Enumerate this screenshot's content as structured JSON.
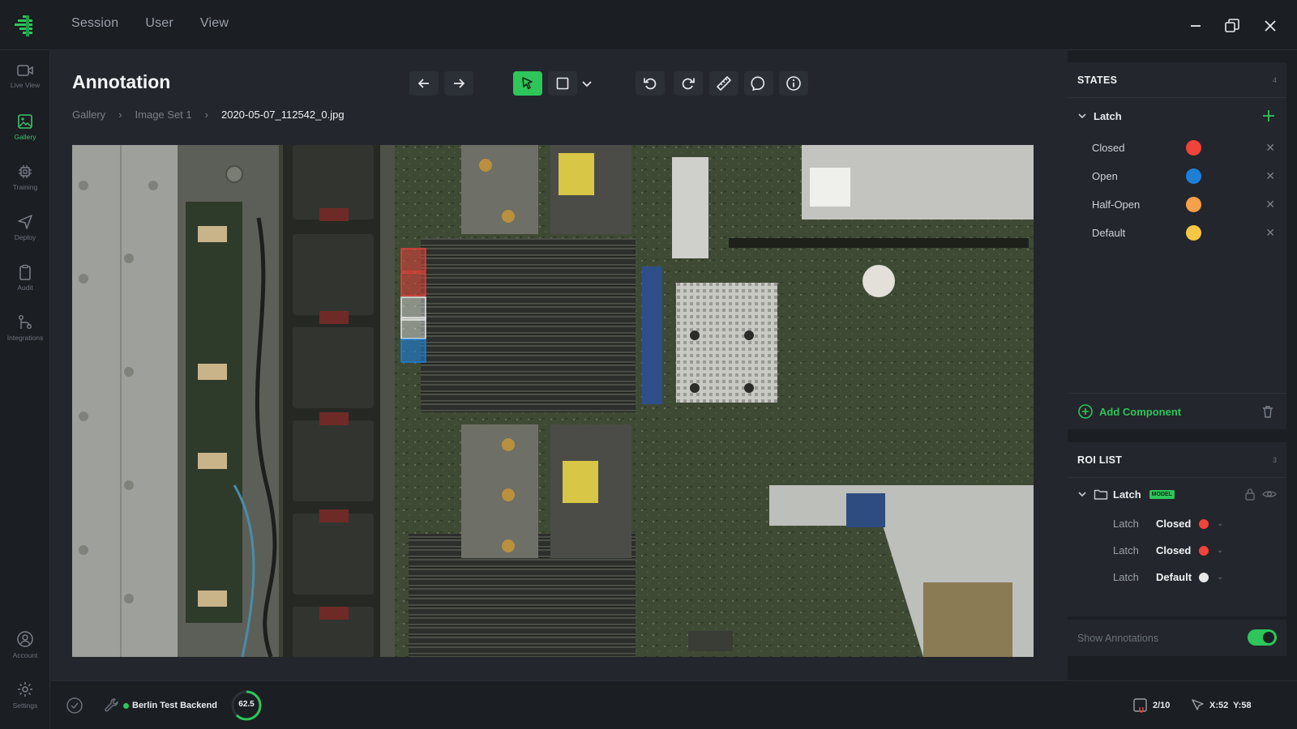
{
  "menu": [
    "Session",
    "User",
    "View"
  ],
  "sidebar": {
    "items": [
      {
        "label": "Live View",
        "icon": "video-camera-icon"
      },
      {
        "label": "Gallery",
        "icon": "image-icon",
        "active": true
      },
      {
        "label": "Training",
        "icon": "chip-icon"
      },
      {
        "label": "Deploy",
        "icon": "send-icon"
      },
      {
        "label": "Audit",
        "icon": "clipboard-icon"
      },
      {
        "label": "Integrations",
        "icon": "integrations-icon"
      }
    ],
    "account_label": "Account",
    "settings_label": "Settings"
  },
  "page": {
    "title": "Annotation",
    "breadcrumb": [
      "Gallery",
      "Image Set 1",
      "2020-05-07_112542_0.jpg"
    ]
  },
  "toolbar": {
    "tools": [
      "arrow-left-icon",
      "arrow-right-icon",
      "pointer-icon",
      "rectangle-icon",
      "chevron-down-icon",
      "undo-icon",
      "redo-icon",
      "ruler-icon",
      "comment-icon",
      "info-icon"
    ],
    "active_tool": "pointer-icon"
  },
  "states": {
    "title": "STATES",
    "count": "4",
    "group": "Latch",
    "items": [
      {
        "label": "Closed",
        "color": "#f0433a"
      },
      {
        "label": "Open",
        "color": "#1d7fd6"
      },
      {
        "label": "Half-Open",
        "color": "#f5a04a"
      },
      {
        "label": "Default",
        "color": "#f6c744"
      }
    ],
    "add_component": "Add Component"
  },
  "roi": {
    "title": "ROI LIST",
    "count": "3",
    "group": "Latch",
    "badge": "MODEL",
    "items": [
      {
        "name": "Latch",
        "state": "Closed",
        "color": "#f0433a"
      },
      {
        "name": "Latch",
        "state": "Closed",
        "color": "#f0433a"
      },
      {
        "name": "Latch",
        "state": "Default",
        "color": "#e8e8e8"
      }
    ],
    "show_annotations": "Show Annotations",
    "show_annotations_on": true
  },
  "status": {
    "backend": "Berlin Test Backend",
    "score": "62.5",
    "score_fraction": 0.625,
    "image_counter": "2/10",
    "cursor": "X:52  Y:58"
  },
  "colors": {
    "accent": "#2ec65a",
    "background": "#1b1e23",
    "panel": "#23262c"
  }
}
